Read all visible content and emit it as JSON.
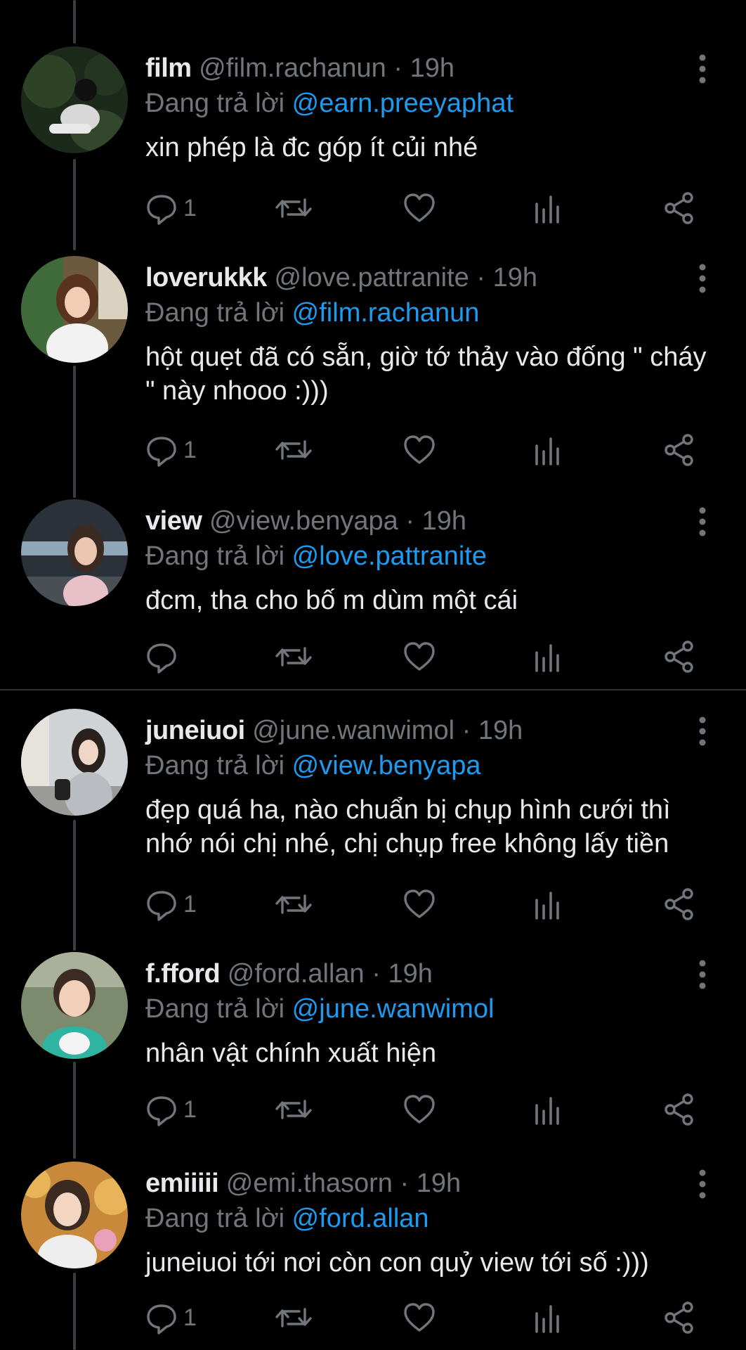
{
  "tweets": [
    {
      "display_name": "film",
      "handle": "@film.rachanun",
      "separator": "·",
      "time": "19h",
      "replying_label": "Đang trả lời",
      "replying_to": "@earn.preeyaphat",
      "text": "xin phép là đc góp ít củi nhé",
      "reply_count": "1"
    },
    {
      "display_name": "loverukkk",
      "handle": "@love.pattranite",
      "separator": "·",
      "time": "19h",
      "replying_label": "Đang trả lời",
      "replying_to": "@film.rachanun",
      "text": "hột quẹt đã có sẵn, giờ tớ thảy vào đống \" cháy \" này nhooo :)))",
      "reply_count": "1"
    },
    {
      "display_name": "view",
      "handle": "@view.benyapa",
      "separator": "·",
      "time": "19h",
      "replying_label": "Đang trả lời",
      "replying_to": "@love.pattranite",
      "text": "đcm, tha cho bố m dùm một cái",
      "reply_count": ""
    },
    {
      "display_name": "juneiuoi",
      "handle": "@june.wanwimol",
      "separator": "·",
      "time": "19h",
      "replying_label": "Đang trả lời",
      "replying_to": "@view.benyapa",
      "text": "đẹp quá ha, nào chuẩn bị chụp hình cưới thì nhớ nói chị nhé, chị chụp free không lấy tiền",
      "reply_count": "1"
    },
    {
      "display_name": "f.fford",
      "handle": "@ford.allan",
      "separator": "·",
      "time": "19h",
      "replying_label": "Đang trả lời",
      "replying_to": "@june.wanwimol",
      "text": "nhân vật chính xuất hiện",
      "reply_count": "1"
    },
    {
      "display_name": "emiiiii",
      "handle": "@emi.thasorn",
      "separator": "·",
      "time": "19h",
      "replying_label": "Đang trả lời",
      "replying_to": "@ford.allan",
      "text": "juneiuoi tới nơi còn con quỷ view tới số :)))",
      "reply_count": "1"
    }
  ],
  "icons": {
    "reply": "reply-icon",
    "retweet": "retweet-icon",
    "like": "heart-icon",
    "views": "analytics-icon",
    "share": "share-icon",
    "more": "more-vertical-icon"
  },
  "colors": {
    "background": "#000000",
    "text": "#e7e9ea",
    "muted": "#71767b",
    "mention": "#1d9bf0",
    "divider": "#2f3336"
  }
}
